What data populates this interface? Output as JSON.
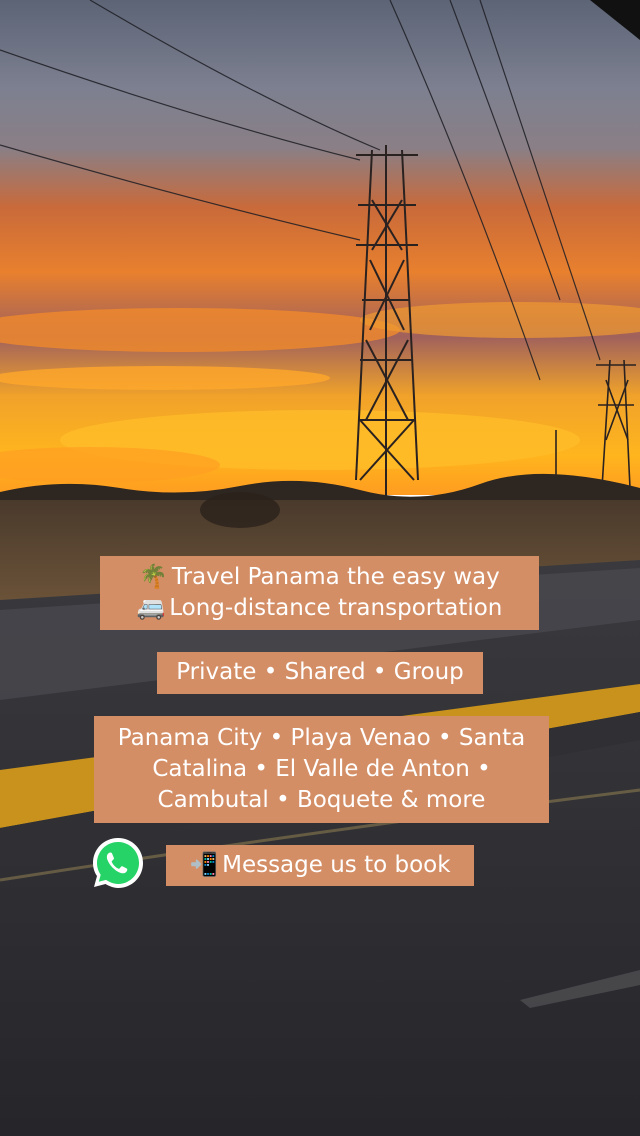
{
  "captions": {
    "line1": "Travel Panama the easy way",
    "line2": "Long-distance transportation",
    "services": "Private • Shared • Group",
    "destinations_1": "Panama City • Playa Venao • Santa",
    "destinations_2": "Catalina • El Valle de Anton •",
    "destinations_3": "Cambutal • Boquete & more",
    "cta": "Message us to book"
  },
  "icons": {
    "palm": "palm-tree-icon",
    "van": "van-icon",
    "phone": "mobile-phone-arrow-icon",
    "whatsapp": "whatsapp-icon"
  },
  "colors": {
    "caption_bg": "#d48e66",
    "caption_text": "#ffffff",
    "whatsapp_green": "#25d366"
  }
}
